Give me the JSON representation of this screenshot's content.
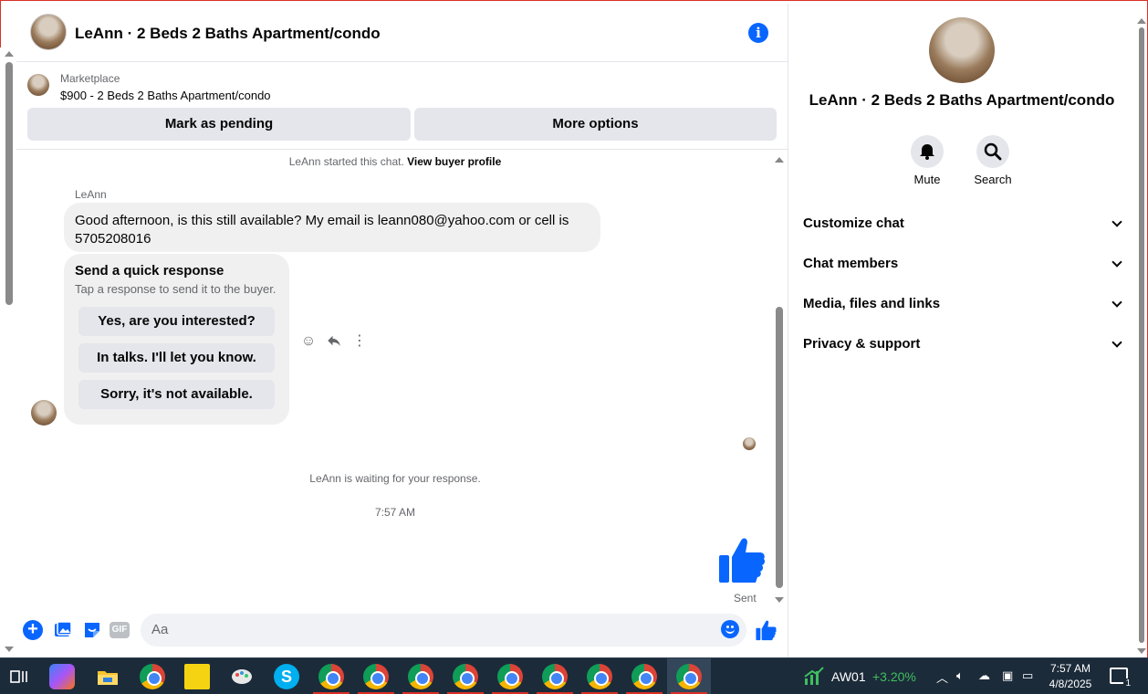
{
  "chat": {
    "title": "LeAnn · 2 Beds 2 Baths Apartment/condo",
    "listing": {
      "label": "Marketplace",
      "price_title": "$900 - 2 Beds 2 Baths Apartment/condo",
      "mark_pending": "Mark as pending",
      "more_options": "More options"
    },
    "started_prefix": "LeAnn started this chat.",
    "view_profile": "View buyer profile",
    "sender_name": "LeAnn",
    "message": "Good afternoon, is this still available? My email is leann080@yahoo.com or cell is 5705208016",
    "quick": {
      "title": "Send a quick response",
      "subtitle": "Tap a response to send it to the buyer.",
      "options": [
        "Yes, are you interested?",
        "In talks. I'll let you know.",
        "Sorry, it's not available."
      ]
    },
    "waiting": "LeAnn is waiting for your response.",
    "time": "7:57 AM",
    "sent": "Sent",
    "composer": {
      "placeholder": "Aa",
      "gif": "GIF"
    }
  },
  "info": {
    "title": "LeAnn · 2 Beds 2 Baths Apartment/condo",
    "mute": "Mute",
    "search": "Search",
    "sections": [
      "Customize chat",
      "Chat members",
      "Media, files and links",
      "Privacy & support"
    ]
  },
  "taskbar": {
    "ticker": "AW01",
    "change": "+3.20%",
    "time": "7:57 AM",
    "date": "4/8/2025",
    "notifications": "1"
  },
  "colors": {
    "accent": "#0866ff",
    "taskbar": "#1c2b3a",
    "gain": "#3fbf5f"
  }
}
